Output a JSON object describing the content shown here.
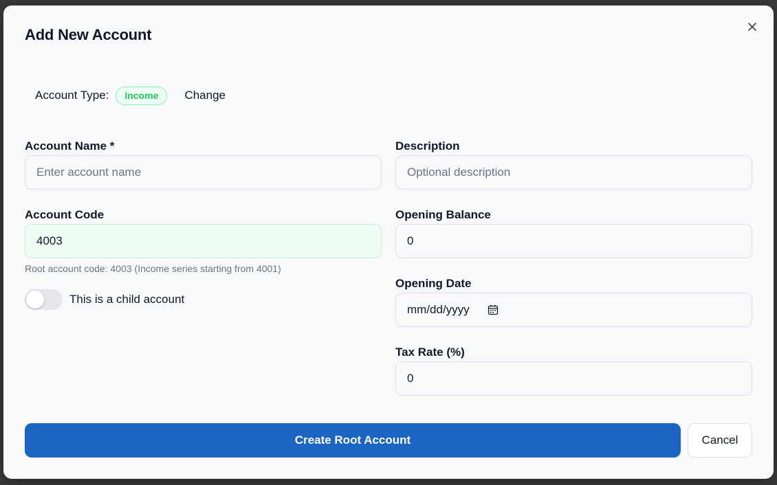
{
  "dialog": {
    "title": "Add New Account",
    "close_icon": "close-icon"
  },
  "account_type": {
    "label": "Account Type:",
    "badge": "Income",
    "badge_color": "#22c55e",
    "change_label": "Change"
  },
  "fields": {
    "account_name": {
      "label": "Account Name *",
      "placeholder": "Enter account name",
      "value": ""
    },
    "description": {
      "label": "Description",
      "placeholder": "Optional description",
      "value": ""
    },
    "account_code": {
      "label": "Account Code",
      "value": "4003",
      "hint": "Root account code: 4003 (Income series starting from 4001)"
    },
    "opening_balance": {
      "label": "Opening Balance",
      "value": "0"
    },
    "opening_date": {
      "label": "Opening Date",
      "placeholder": "mm/dd/yyyy",
      "icon": "calendar-icon"
    },
    "tax_rate": {
      "label": "Tax Rate (%)",
      "value": "0"
    }
  },
  "child_toggle": {
    "label": "This is a child account",
    "on": false
  },
  "actions": {
    "primary_label": "Create Root Account",
    "primary_color": "#1c64c2",
    "cancel_label": "Cancel"
  }
}
